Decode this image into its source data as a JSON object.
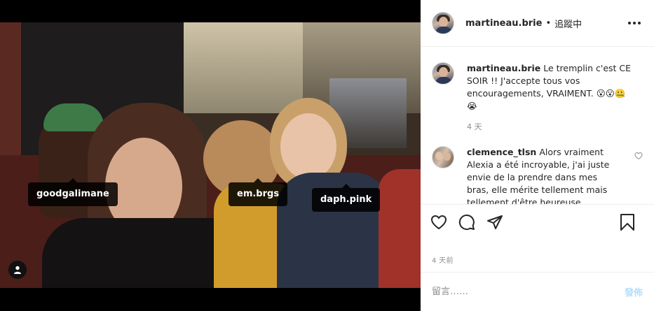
{
  "post": {
    "username": "martineau.brie",
    "follow_status": "追蹤中",
    "separator": "•",
    "caption": "Le tremplin c'est CE SOIR !! J'accepte tous vos encouragements, VRAIMENT. 😮😮🤐😭",
    "caption_time": "4 天",
    "post_date": "4 天前"
  },
  "photo_tags": [
    {
      "label": "goodgalimane"
    },
    {
      "label": "em.brgs"
    },
    {
      "label": "daph.pink"
    }
  ],
  "comments": [
    {
      "username": "clemence_tlsn",
      "text": "Alors vraiment Alexia a été incroyable, j'ai juste envie de la prendre dans mes bras, elle mérite tellement mais tellement d'être heureuse"
    }
  ],
  "add_comment": {
    "placeholder": "留言……",
    "post_label": "發佈"
  },
  "colors": {
    "accent_disabled": "#b2dffc",
    "secondary_text": "#8e8e8e",
    "primary_text": "#262626",
    "divider": "#efefef"
  },
  "icons": {
    "like": "heart-icon",
    "comment": "comment-icon",
    "share": "paper-plane-icon",
    "save": "bookmark-icon",
    "options": "more-options-icon",
    "tagged_users": "user-icon"
  }
}
